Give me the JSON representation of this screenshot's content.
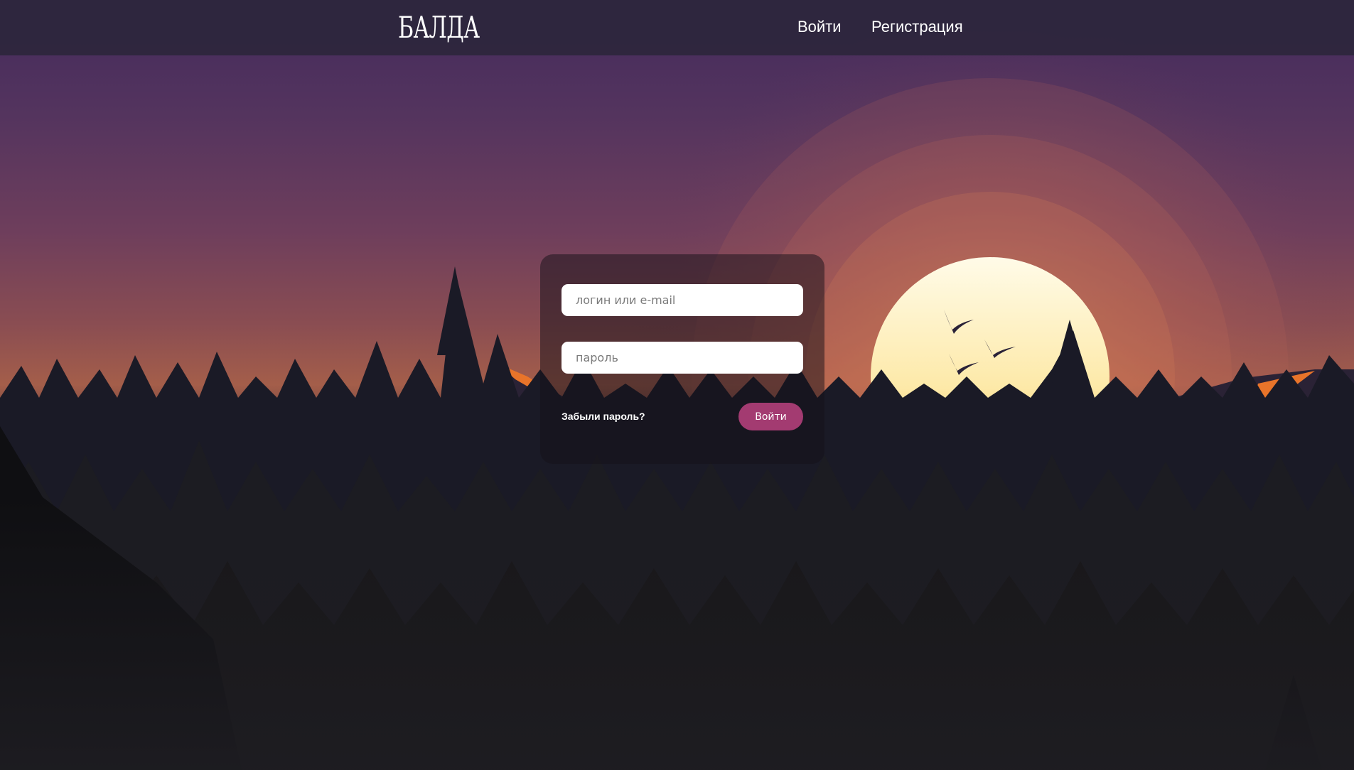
{
  "header": {
    "logo": "БАЛДА",
    "nav": {
      "login": "Войти",
      "register": "Регистрация"
    }
  },
  "login_form": {
    "login_placeholder": "логин или e-mail",
    "password_placeholder": "пароль",
    "forgot_password": "Забыли пароль?",
    "submit_label": "Войти"
  },
  "colors": {
    "header_bg": "#2c263c",
    "accent_button": "#a33b71",
    "sun": "#fde9a8"
  },
  "background": {
    "scene": "sunset-forest-illustration",
    "elements": [
      "sun",
      "birds",
      "pine-trees",
      "mountains"
    ]
  }
}
